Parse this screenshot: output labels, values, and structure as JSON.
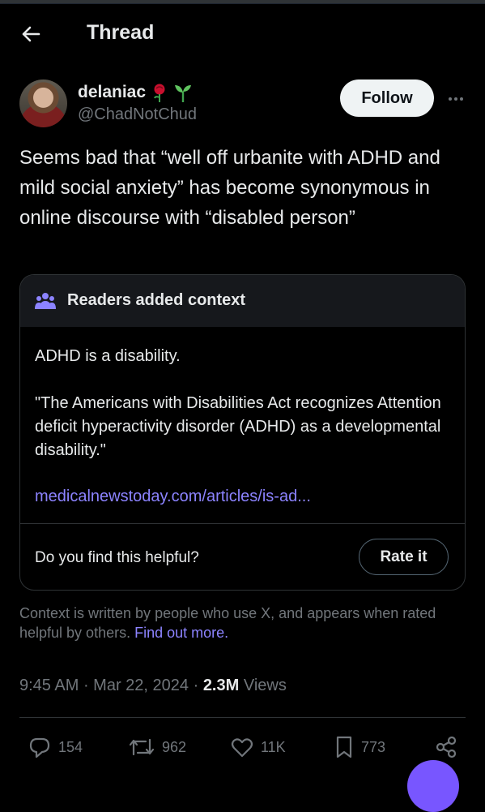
{
  "header": {
    "title": "Thread"
  },
  "author": {
    "display_name": "delaniac",
    "emojis": "🌹🌱",
    "handle": "@ChadNotChud",
    "follow_label": "Follow"
  },
  "tweet": {
    "text": "Seems bad that “well off urbanite with ADHD and mild social anxiety” has become synonymous in online discourse with “disabled person”"
  },
  "community_note": {
    "title": "Readers added context",
    "paragraph1": "ADHD is a disability.",
    "paragraph2": "\"The Americans with Disabilities Act recognizes Attention deficit hyperactivity disorder (ADHD) as a developmental disability.\"",
    "link": "medicalnewstoday.com/articles/is-ad...",
    "helpful_prompt": "Do you find this helpful?",
    "rate_label": "Rate it"
  },
  "context_footer": {
    "text": "Context is written by people who use X, and appears when rated helpful by others.",
    "link": "Find out more."
  },
  "meta": {
    "time": "9:45 AM",
    "date": "Mar 22, 2024",
    "views_count": "2.3M",
    "views_label": "Views"
  },
  "actions": {
    "replies": "154",
    "reposts": "962",
    "likes": "11K",
    "bookmarks": "773"
  },
  "colors": {
    "background": "#000000",
    "text": "#e7e9ea",
    "muted": "#71767b",
    "accent": "#8c83ff",
    "fab": "#7856ff"
  },
  "icons": [
    "back-arrow-icon",
    "rose-icon",
    "seedling-icon",
    "more-icon",
    "people-icon",
    "reply-icon",
    "repost-icon",
    "like-icon",
    "bookmark-icon",
    "share-icon"
  ]
}
